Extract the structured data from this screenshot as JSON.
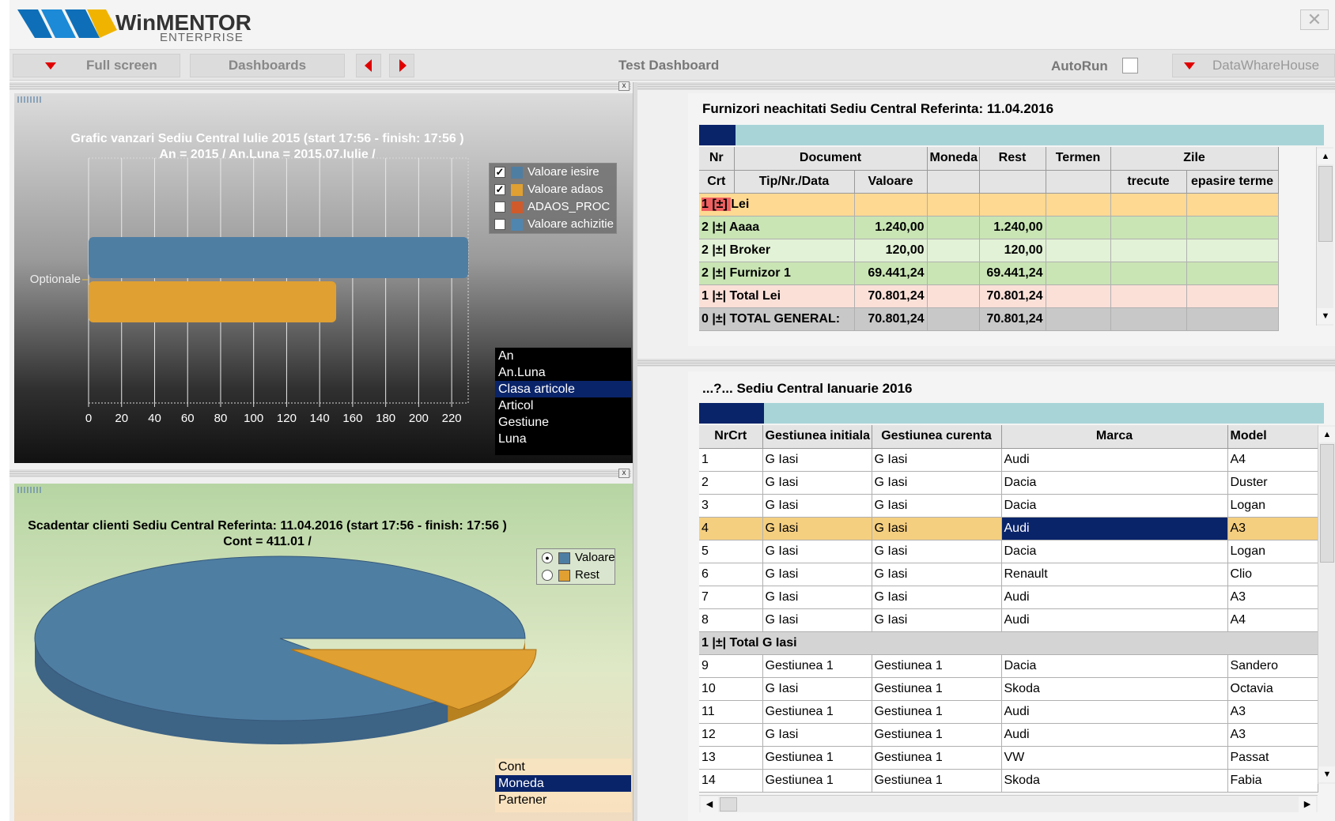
{
  "app": {
    "logo_win": "WinMENTOR",
    "logo_sub": "ENTERPRISE",
    "close_glyph": "✕"
  },
  "toolbar": {
    "fullscreen_label": "Full screen",
    "dashboards_label": "Dashboards",
    "title": "Test Dashboard",
    "autorun_label": "AutoRun",
    "warehouse_label": "DataWhareHouse"
  },
  "sales_chart": {
    "title_line1": "Grafic vanzari  Sediu Central  Iulie 2015 (start 17:56 - finish:  17:56 )",
    "title_line2": "An = 2015 / An.Luna = 2015.07.Iulie /",
    "legend": [
      {
        "label": "Valoare iesire",
        "checked": true,
        "color": "#4f7ea3"
      },
      {
        "label": "Valoare adaos",
        "checked": true,
        "color": "#e0a032"
      },
      {
        "label": "ADAOS_PROC",
        "checked": false,
        "color": "#d05a2a"
      },
      {
        "label": "Valoare achizitie",
        "checked": false,
        "color": "#4f86b0"
      }
    ],
    "dimensions": [
      "An",
      "An.Luna",
      "Clasa articole",
      "Articol",
      "Gestiune",
      "Luna"
    ],
    "selected_dimension": "Clasa articole"
  },
  "sched_chart": {
    "title_line1": "Scadentar clienti  Sediu Central Referinta: 11.04.2016 (start 17:56 - finish:  17:56 )",
    "title_line2": "Cont = 411.01 /",
    "legend": [
      {
        "label": "Valoare",
        "selected": true,
        "color": "#4f7ea3"
      },
      {
        "label": "Rest",
        "selected": false,
        "color": "#e0a032"
      }
    ],
    "dimensions": [
      "Cont",
      "Moneda",
      "Partener"
    ],
    "selected_dimension": "Moneda"
  },
  "chart_data": [
    {
      "type": "bar",
      "orientation": "horizontal",
      "categories": [
        "Optionale"
      ],
      "series": [
        {
          "name": "Valoare iesire",
          "values": [
            233
          ]
        },
        {
          "name": "Valoare adaos",
          "values": [
            150
          ]
        }
      ],
      "xlim": [
        0,
        230
      ],
      "xticks": [
        0,
        20,
        40,
        60,
        80,
        100,
        120,
        140,
        160,
        180,
        200,
        220
      ],
      "grid": true,
      "legend_position": "top-right"
    },
    {
      "type": "pie",
      "labels": [
        "Valoare",
        "Rest"
      ],
      "values": [
        87,
        13
      ],
      "legend_position": "right"
    }
  ],
  "suppliers": {
    "title": "Furnizori neachitati  Sediu Central Referinta: 11.04.2016",
    "headers": {
      "nr": "Nr",
      "crt": "Crt",
      "document": "Document",
      "tip": "Tip/Nr./Data",
      "valoare": "Valoare",
      "moneda": "Moneda",
      "rest": "Rest",
      "termen": "Termen",
      "zile": "Zile",
      "trecute": "trecute",
      "depasire": "epasire terme"
    },
    "rows": [
      {
        "lvl": "1 [±]",
        "name": "Lei",
        "valoare": "",
        "rest": "",
        "style": "group"
      },
      {
        "lvl": "2 |±|",
        "name": "Aaaa",
        "valoare": "1.240,00",
        "rest": "1.240,00",
        "style": "green"
      },
      {
        "lvl": "2 |±|",
        "name": "Broker",
        "valoare": "120,00",
        "rest": "120,00",
        "style": "lightgreen"
      },
      {
        "lvl": "2 |±|",
        "name": "Furnizor 1",
        "valoare": "69.441,24",
        "rest": "69.441,24",
        "style": "green"
      },
      {
        "lvl": "1 |±|",
        "name": "Total Lei",
        "valoare": "70.801,24",
        "rest": "70.801,24",
        "style": "pink"
      },
      {
        "lvl": "0 |±|",
        "name": "TOTAL GENERAL:",
        "valoare": "70.801,24",
        "rest": "70.801,24",
        "style": "gray"
      }
    ]
  },
  "cars": {
    "title": "...?...  Sediu Central  Ianuarie 2016",
    "headers": {
      "nrcrt": "NrCrt",
      "gi": "Gestiunea initiala",
      "gc": "Gestiunea curenta",
      "marca": "Marca",
      "model": "Model"
    },
    "rows": [
      {
        "nr": "1",
        "gi": "G Iasi",
        "gc": "G Iasi",
        "marca": "Audi",
        "model": "A4"
      },
      {
        "nr": "2",
        "gi": "G Iasi",
        "gc": "G Iasi",
        "marca": "Dacia",
        "model": "Duster"
      },
      {
        "nr": "3",
        "gi": "G Iasi",
        "gc": "G Iasi",
        "marca": "Dacia",
        "model": "Logan"
      },
      {
        "nr": "4",
        "gi": "G Iasi",
        "gc": "G Iasi",
        "marca": "Audi",
        "model": "A3",
        "selected": true
      },
      {
        "nr": "5",
        "gi": "G Iasi",
        "gc": "G Iasi",
        "marca": "Dacia",
        "model": "Logan"
      },
      {
        "nr": "6",
        "gi": "G Iasi",
        "gc": "G Iasi",
        "marca": "Renault",
        "model": "Clio"
      },
      {
        "nr": "7",
        "gi": "G Iasi",
        "gc": "G Iasi",
        "marca": "Audi",
        "model": "A3"
      },
      {
        "nr": "8",
        "gi": "G Iasi",
        "gc": "G Iasi",
        "marca": "Audi",
        "model": "A4"
      },
      {
        "nr": "1 |±| Total G Iasi",
        "gi": "",
        "gc": "",
        "marca": "",
        "model": "",
        "total": true
      },
      {
        "nr": "9",
        "gi": "Gestiunea 1",
        "gc": "Gestiunea 1",
        "marca": "Dacia",
        "model": "Sandero"
      },
      {
        "nr": "10",
        "gi": "G Iasi",
        "gc": "Gestiunea 1",
        "marca": "Skoda",
        "model": "Octavia"
      },
      {
        "nr": "11",
        "gi": "Gestiunea 1",
        "gc": "Gestiunea 1",
        "marca": "Audi",
        "model": "A3"
      },
      {
        "nr": "12",
        "gi": "G Iasi",
        "gc": "Gestiunea 1",
        "marca": "Audi",
        "model": "A3"
      },
      {
        "nr": "13",
        "gi": "Gestiunea 1",
        "gc": "Gestiunea 1",
        "marca": "VW",
        "model": "Passat"
      },
      {
        "nr": "14",
        "gi": "Gestiunea 1",
        "gc": "Gestiunea 1",
        "marca": "Skoda",
        "model": "Fabia"
      }
    ]
  },
  "colors": {
    "accent_red": "#e00000",
    "selection_navy": "#0a246a",
    "bar_blue": "#4f7ea3",
    "bar_orange": "#e0a032",
    "row_green": "#c9e5b4",
    "row_lightgreen": "#e2f2d6",
    "row_pink": "#fbe0d8",
    "row_group": "#fdd992",
    "row_selected": "#f5cf80"
  }
}
